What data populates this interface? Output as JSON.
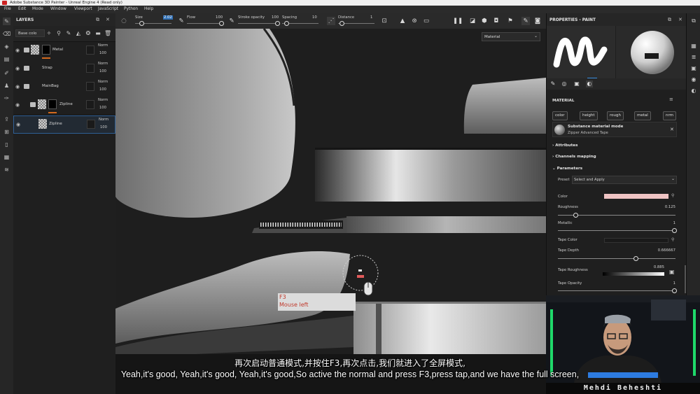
{
  "window": {
    "title": "Adobe Substance 3D Painter - Unreal Engine 4 (Read only)"
  },
  "menu": [
    "File",
    "Edit",
    "Mode",
    "Window",
    "Viewport",
    "JavaScript",
    "Python",
    "Help"
  ],
  "toolbar": {
    "size_label": "Size",
    "size_value": "2.02",
    "flow_label": "Flow",
    "flow_value": "100",
    "stroke_opacity_label": "Stroke opacity",
    "stroke_opacity_value": "100",
    "spacing_label": "Spacing",
    "spacing_value": "10",
    "distance_label": "Distance",
    "distance_value": "1"
  },
  "layers": {
    "title": "LAYERS",
    "blend_select": "Base colo",
    "items": [
      {
        "name": "Metal",
        "blend": "Norm",
        "opacity": "100"
      },
      {
        "name": "Strap",
        "blend": "Norm",
        "opacity": "100"
      },
      {
        "name": "MainBag",
        "blend": "Norm",
        "opacity": "100"
      },
      {
        "name": "Zipline",
        "blend": "Norm",
        "opacity": "100"
      },
      {
        "name": "Zipline",
        "blend": "Norm",
        "opacity": "100"
      }
    ]
  },
  "viewport": {
    "channel_select": "Material",
    "key_hint": {
      "key": "F3",
      "action": "Mouse left"
    }
  },
  "properties": {
    "title": "PROPERTIES - PAINT",
    "material_section": "MATERIAL",
    "chips": [
      "color",
      "height",
      "rough",
      "metal",
      "nrm"
    ],
    "material_mode": {
      "title": "Substance material mode",
      "name": "Zipper Advanced Tape"
    },
    "sections": {
      "attributes": "Attributes",
      "channels": "Channels mapping",
      "parameters": "Parameters"
    },
    "preset_label": "Preset",
    "preset_value": "Select and Apply",
    "params": {
      "color_label": "Color",
      "color_swatch": "#efc3c3",
      "roughness_label": "Roughness",
      "roughness_value": "0.125",
      "metallic_label": "Metallic",
      "metallic_value": "1",
      "tape_color_label": "Tape Color",
      "tape_color_swatch": "#1a1a1a",
      "tape_depth_label": "Tape Depth",
      "tape_depth_value": "0.666667",
      "tape_roughness_label": "Tape Roughness",
      "tape_roughness_value": "0.885",
      "tape_opacity_label": "Tape Opacity",
      "tape_opacity_value": "1"
    }
  },
  "webcam": {
    "name": "Mehdi Beheshti"
  },
  "subtitles": {
    "cn": "再次启动普通模式,并按住F3,再次点击,我们就进入了全屏模式,",
    "en": "Yeah,it's good, Yeah,it's good, Yeah,it's good,So active the normal and press F3,press tap,and we have the full screen,"
  }
}
